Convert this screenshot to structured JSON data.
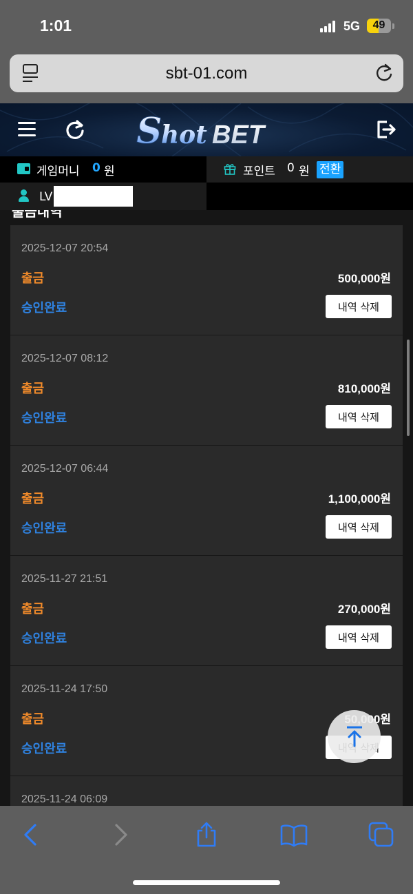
{
  "status_bar": {
    "time": "1:01",
    "network": "5G",
    "battery": "49"
  },
  "browser": {
    "url": "sbt-01.com"
  },
  "site": {
    "logo_text_1": "Shot",
    "logo_text_2": "BET",
    "game_money_label": "게임머니",
    "game_money_value": "0",
    "money_unit": "원",
    "point_label": "포인트",
    "point_value": "0",
    "point_unit": "원",
    "convert_label": "전환",
    "level_label": "LV"
  },
  "section_title": "출금내역",
  "transactions": [
    {
      "date": "2025-12-07 20:54",
      "type": "출금",
      "amount": "500,000원",
      "status": "승인완료",
      "delete_label": "내역 삭제"
    },
    {
      "date": "2025-12-07 08:12",
      "type": "출금",
      "amount": "810,000원",
      "status": "승인완료",
      "delete_label": "내역 삭제"
    },
    {
      "date": "2025-12-07 06:44",
      "type": "출금",
      "amount": "1,100,000원",
      "status": "승인완료",
      "delete_label": "내역 삭제"
    },
    {
      "date": "2025-11-27 21:51",
      "type": "출금",
      "amount": "270,000원",
      "status": "승인완료",
      "delete_label": "내역 삭제"
    },
    {
      "date": "2025-11-24 17:50",
      "type": "출금",
      "amount": "50,000원",
      "status": "승인완료",
      "delete_label": "내역 삭제"
    },
    {
      "date": "2025-11-24 06:09",
      "type": "",
      "amount": "",
      "status": "",
      "delete_label": ""
    }
  ],
  "colors": {
    "withdraw_type": "#f08a2a",
    "approved_status": "#2f82e0",
    "accent": "#1aa3ff",
    "teal_icon": "#22c7c5"
  },
  "icons": [
    "menu-icon",
    "refresh-icon",
    "logout-icon",
    "wallet-icon",
    "gift-icon",
    "user-icon",
    "scroll-top-icon",
    "back-icon",
    "forward-icon",
    "share-icon",
    "bookmarks-icon",
    "tabs-icon"
  ]
}
